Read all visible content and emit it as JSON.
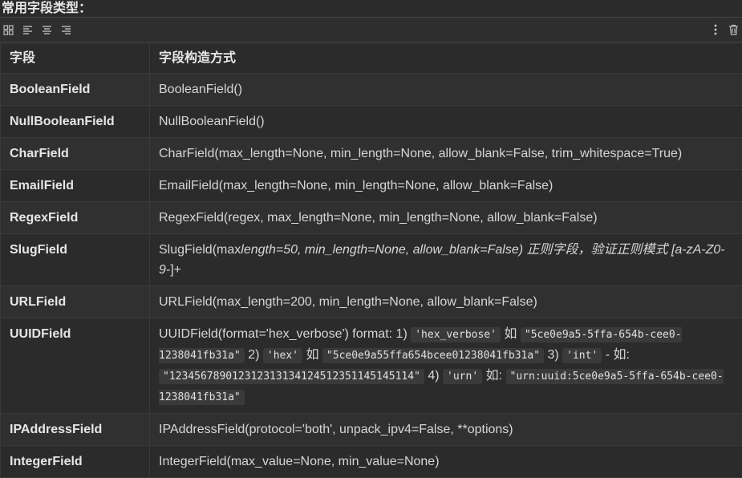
{
  "heading": "常用字段类型：",
  "table": {
    "headers": {
      "field": "字段",
      "constructor": "字段构造方式"
    },
    "rows": [
      {
        "name": "BooleanField",
        "cons": "BooleanField()"
      },
      {
        "name": "NullBooleanField",
        "cons": "NullBooleanField()"
      },
      {
        "name": "CharField",
        "cons": "CharField(max_length=None, min_length=None, allow_blank=False, trim_whitespace=True)"
      },
      {
        "name": "EmailField",
        "cons": "EmailField(max_length=None, min_length=None, allow_blank=False)"
      },
      {
        "name": "RegexField",
        "cons": "RegexField(regex, max_length=None, min_length=None, allow_blank=False)"
      },
      {
        "name": "SlugField",
        "cons_a": "SlugField(max",
        "cons_b": "length=50, min_length=None, allow_blank=False) 正则字段，验证正则模式 [a-zA-Z0-9-",
        "cons_c": "]+"
      },
      {
        "name": "URLField",
        "cons": "URLField(max_length=200, min_length=None, allow_blank=False)"
      },
      {
        "name": "UUIDField",
        "p1": "UUIDField(format='hex_verbose') format: 1) ",
        "c1": "'hex_verbose'",
        "p2": " 如 ",
        "c2": "\"5ce0e9a5-5ffa-654b-cee0-1238041fb31a\"",
        "p3": " 2) ",
        "c3": "'hex'",
        "p4": " 如 ",
        "c4": "\"5ce0e9a55ffa654bcee01238041fb31a\"",
        "p5": " 3) ",
        "c5": "'int'",
        "p6": " - 如: ",
        "c6": "\"123456789012312313134124512351145145114\"",
        "p7": " 4) ",
        "c7": "'urn'",
        "p8": " 如: ",
        "c8": "\"urn:uuid:5ce0e9a5-5ffa-654b-cee0-1238041fb31a\""
      },
      {
        "name": "IPAddressField",
        "cons": "IPAddressField(protocol='both', unpack_ipv4=False, **options)"
      },
      {
        "name": "IntegerField",
        "cons": "IntegerField(max_value=None, min_value=None)"
      }
    ]
  },
  "icons": [
    "table-grid-icon",
    "align-left-icon",
    "align-center-icon",
    "align-right-icon",
    "more-vertical-icon",
    "trash-icon"
  ],
  "colors": {
    "background": "#2b2b2b",
    "border": "#3a3a3a",
    "text": "#dcdcdc",
    "code_bg": "#3a3a3a"
  }
}
